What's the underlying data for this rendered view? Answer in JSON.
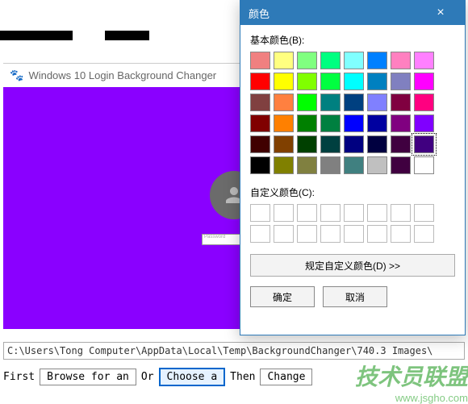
{
  "window": {
    "title": "Windows 10 Login Background Changer"
  },
  "preview": {
    "password_placeholder": "Password"
  },
  "path": {
    "value": "C:\\Users\\Tong Computer\\AppData\\Local\\Temp\\BackgroundChanger\\740.3  Images\\"
  },
  "cmdrow": {
    "first": "First",
    "browse": "Browse for an",
    "or": "Or",
    "choose": "Choose a",
    "then": "Then",
    "change": "Change"
  },
  "dialog": {
    "title": "颜色",
    "basic_label": "基本颜色(B):",
    "custom_label": "自定义颜色(C):",
    "define": "规定自定义颜色(D) >>",
    "ok": "确定",
    "cancel": "取消",
    "selected_index": 39,
    "basic_colors": [
      "#f08080",
      "#ffff80",
      "#80ff80",
      "#00ff80",
      "#80ffff",
      "#0080ff",
      "#ff80c0",
      "#ff80ff",
      "#ff0000",
      "#ffff00",
      "#80ff00",
      "#00ff40",
      "#00ffff",
      "#0080c0",
      "#8080c0",
      "#ff00ff",
      "#804040",
      "#ff8040",
      "#00ff00",
      "#008080",
      "#004080",
      "#8080ff",
      "#800040",
      "#ff0080",
      "#800000",
      "#ff8000",
      "#008000",
      "#008040",
      "#0000ff",
      "#0000a0",
      "#800080",
      "#8000ff",
      "#400000",
      "#804000",
      "#004000",
      "#004040",
      "#000080",
      "#000040",
      "#400040",
      "#400080",
      "#000000",
      "#808000",
      "#808040",
      "#808080",
      "#408080",
      "#c0c0c0",
      "#400040",
      "#ffffff"
    ]
  },
  "watermark": {
    "text": "技术员联盟",
    "url": "www.jsgho.com"
  }
}
